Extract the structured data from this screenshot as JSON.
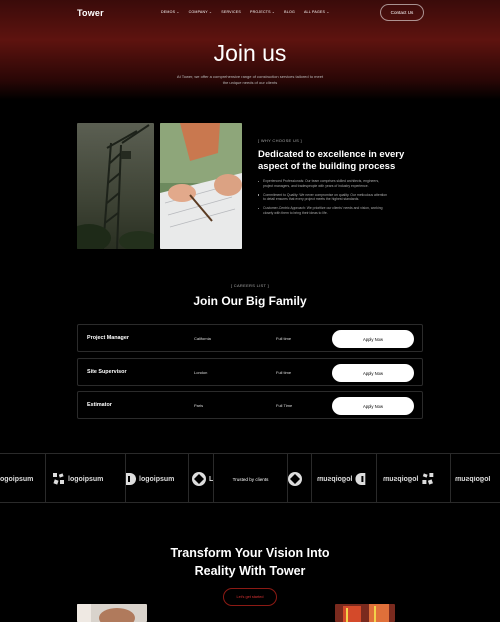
{
  "nav": {
    "brand": "Tower",
    "items": [
      "DEMOS ⌄",
      "COMPANY ⌄",
      "SERVICES",
      "PROJECTS ⌄",
      "BLOG",
      "ALL PAGES ⌄"
    ],
    "contact_label": "Contact Us"
  },
  "hero": {
    "title": "Join us",
    "subtitle": "At Tower, we offer a comprehensive range of construction services tailored to meet the unique needs of our clients"
  },
  "why": {
    "tag": "[ WHY CHOOSE US ]",
    "title": "Dedicated to excellence in every aspect of the building process",
    "points": [
      "Experienced Professionals: Our team comprises skilled architects, engineers, project managers, and tradespeople with years of industry experience.",
      "Commitment to Quality: We never compromise on quality. Our meticulous attention to detail ensures that every project meets the highest standards.",
      "Customer-Centric Approach: We prioritize our clients' needs and vision, working closely with them to bring their ideas to life."
    ]
  },
  "careers": {
    "tag": "[ CAREERS LIST ]",
    "title": "Join Our Big Family",
    "apply_label": "Apply Now",
    "jobs": [
      {
        "title": "Project Manager",
        "location": "California",
        "type": "Full time"
      },
      {
        "title": "Site Supervisor",
        "location": "London",
        "type": "Full time"
      },
      {
        "title": "Estimator",
        "location": "Paris",
        "type": "Full Time"
      }
    ]
  },
  "logos": {
    "logo_text": "logoipsum",
    "trusted": "Trusted by clients"
  },
  "cta": {
    "title": "Transform Your Vision Into Reality With Tower",
    "button": "Let's get started"
  }
}
